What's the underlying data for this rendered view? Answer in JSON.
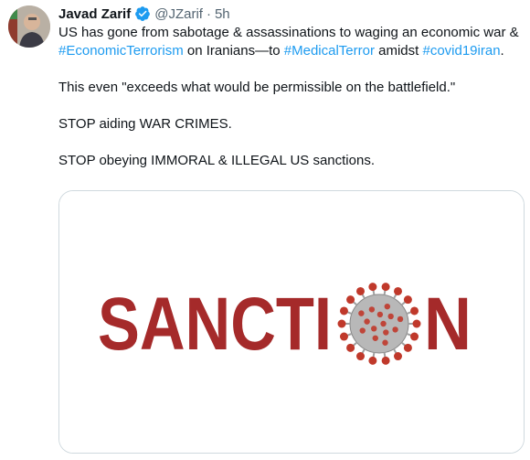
{
  "tweet": {
    "author_name": "Javad Zarif",
    "handle": "@JZarif",
    "separator": "·",
    "time": "5h",
    "line1": {
      "text_a": "US has gone from sabotage & assassinations to waging an economic war & ",
      "tag_a": "#EconomicTerrorism",
      "text_b": " on Iranians—to ",
      "tag_b": "#MedicalTerror",
      "text_c": " amidst ",
      "tag_c": "#covid19iran",
      "text_d": "."
    },
    "line2": "This even \"exceeds what would be permissible on the battlefield.\"",
    "line3": "STOP aiding WAR CRIMES.",
    "line4": "STOP obeying IMMORAL & ILLEGAL US sanctions."
  },
  "media": {
    "word_left": "SANCTI",
    "word_right": "N",
    "word_color": "#a52a2a",
    "virus_color": "#c0392b"
  },
  "icons": [
    "verified-badge-icon",
    "avatar"
  ]
}
